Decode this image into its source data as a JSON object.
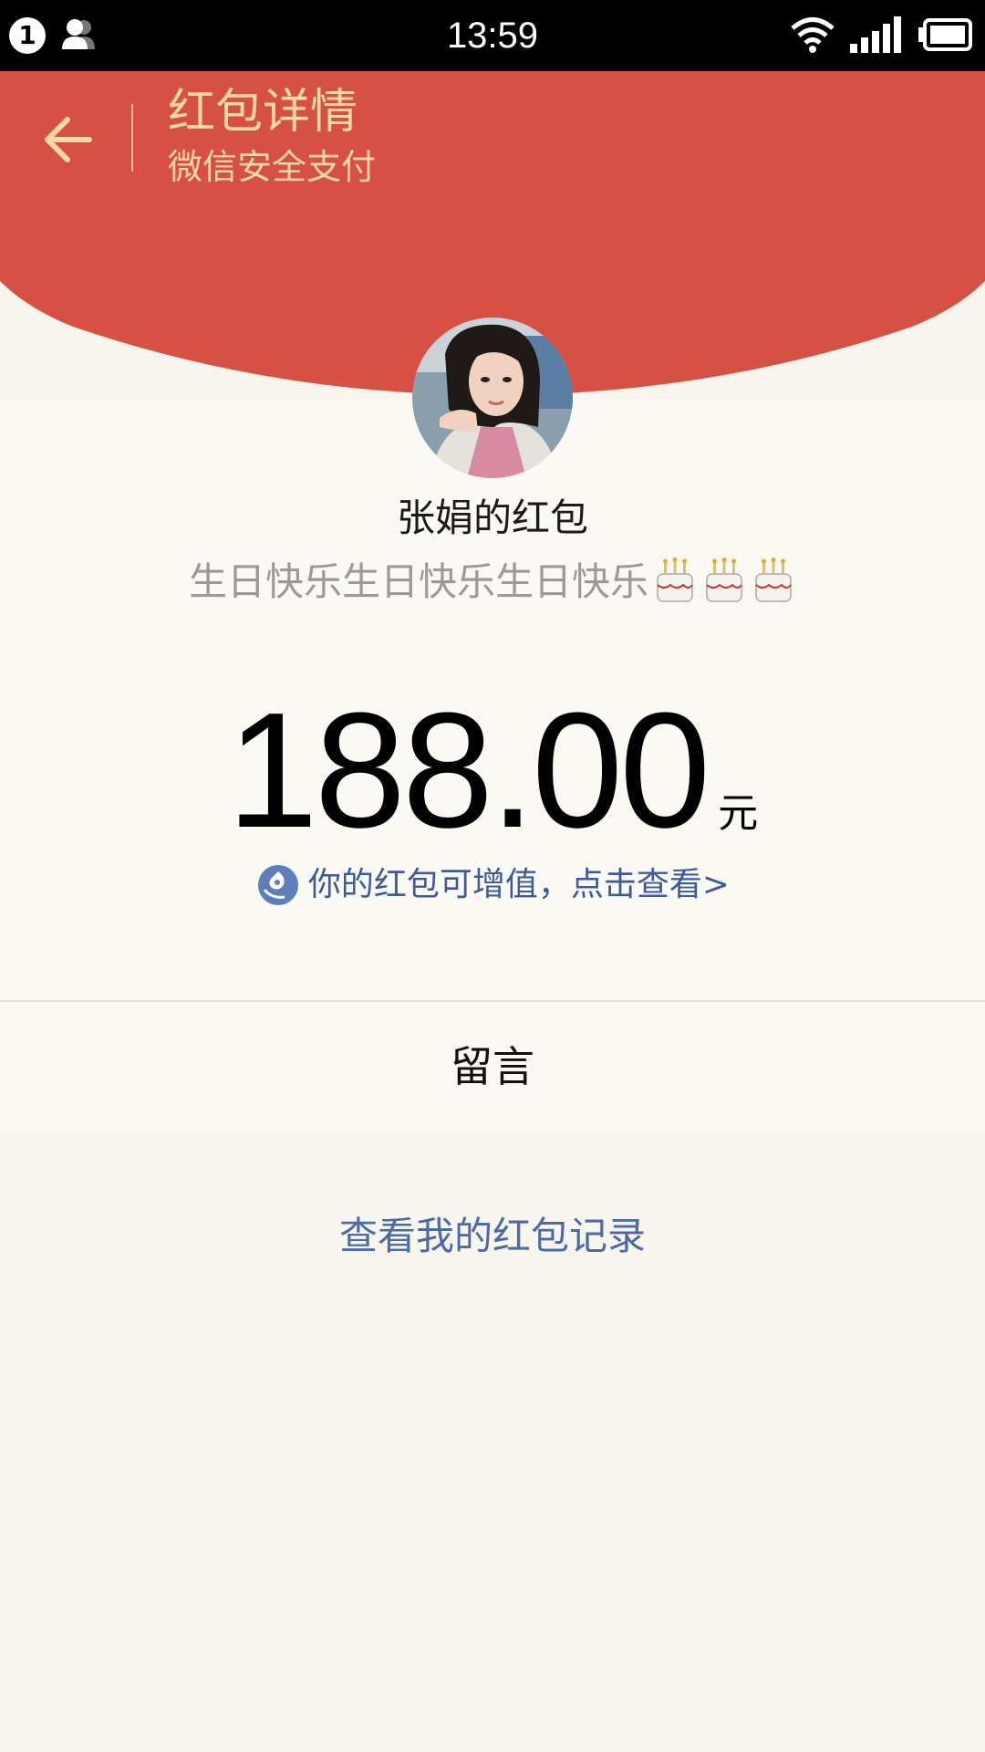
{
  "status_bar": {
    "notification_count": "1",
    "time": "13:59"
  },
  "header": {
    "title": "红包详情",
    "subtitle": "微信安全支付",
    "color": "#d65043"
  },
  "packet": {
    "sender_title": "张娟的红包",
    "message": "生日快乐生日快乐生日快乐",
    "emoji_count": 3,
    "amount": "188.00",
    "unit": "元",
    "invest_link": "你的红包可增值，点击查看>"
  },
  "message_row": {
    "label": "留言"
  },
  "footer": {
    "history_link": "查看我的红包记录"
  },
  "colors": {
    "header_red": "#d65043",
    "title_gold": "#f8d9a2",
    "link_blue": "#4c6aa3",
    "background": "#f8f5ef"
  }
}
